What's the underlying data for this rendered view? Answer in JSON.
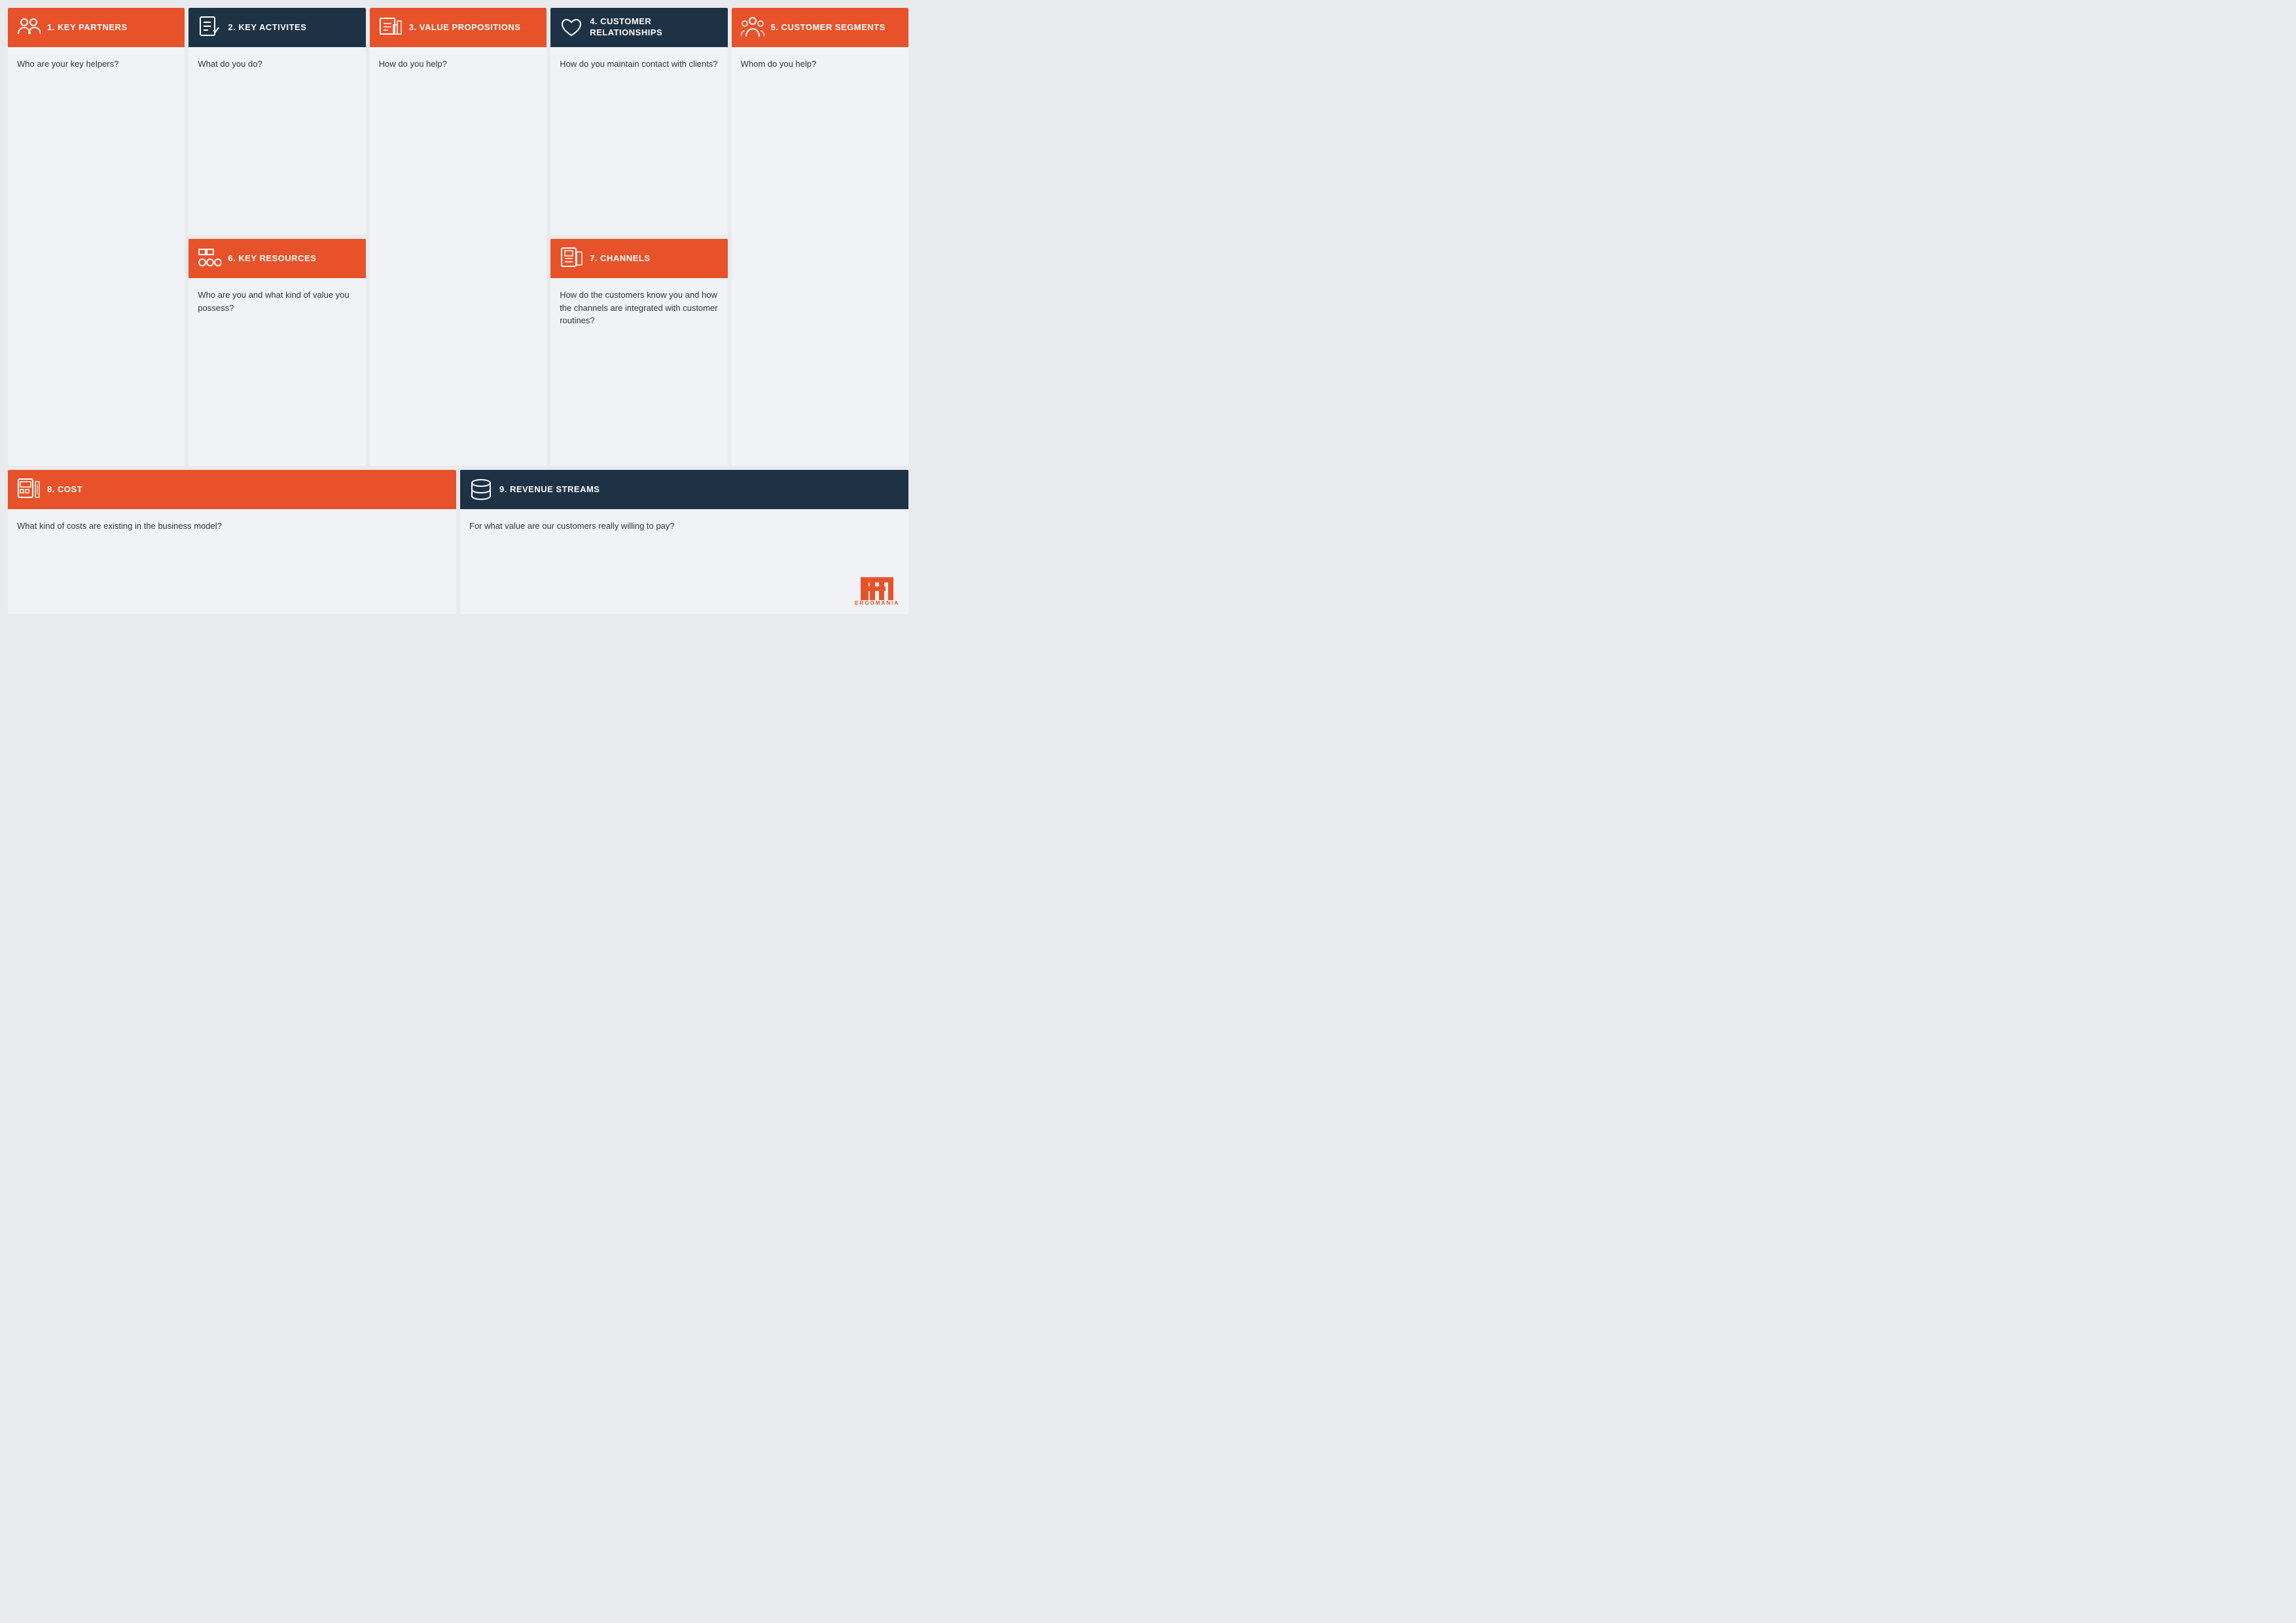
{
  "sections": {
    "key_partners": {
      "number": "1.",
      "title": "KEY PARTNERS",
      "body": "Who are your key helpers?",
      "color": "orange",
      "icon": "partners-icon"
    },
    "key_activities": {
      "number": "2.",
      "title": "KEY ACTIVITES",
      "body": "What do you do?",
      "color": "dark-blue",
      "icon": "activities-icon"
    },
    "value_propositions": {
      "number": "3.",
      "title": "VALUE PROPOSITIONS",
      "body": "How do you help?",
      "color": "orange",
      "icon": "value-icon"
    },
    "customer_relationships": {
      "number": "4.",
      "title": "CUSTOMER RELATIONSHIPS",
      "body": "How do you maintain contact with clients?",
      "color": "dark-blue",
      "icon": "relationships-icon"
    },
    "customer_segments": {
      "number": "5.",
      "title": "CUSTOMER SEGMENTS",
      "body": "Whom do you help?",
      "color": "orange",
      "icon": "segments-icon"
    },
    "key_resources": {
      "number": "6.",
      "title": "KEY RESOURCES",
      "body": "Who are you and what kind of value you possess?",
      "color": "orange",
      "icon": "resources-icon"
    },
    "channels": {
      "number": "7.",
      "title": "CHANNELS",
      "body": "How do the customers know you and how the channels are integrated with customer routines?",
      "color": "orange",
      "icon": "channels-icon"
    },
    "cost": {
      "number": "8.",
      "title": "COST",
      "body": "What kind of costs are existing in the business model?",
      "color": "orange",
      "icon": "cost-icon"
    },
    "revenue": {
      "number": "9.",
      "title": "REVENUE STREAMS",
      "body": "For what value are our customers really willing to pay?",
      "color": "dark-blue",
      "icon": "revenue-icon"
    }
  },
  "logo": {
    "text": "ERGOMANIA"
  }
}
